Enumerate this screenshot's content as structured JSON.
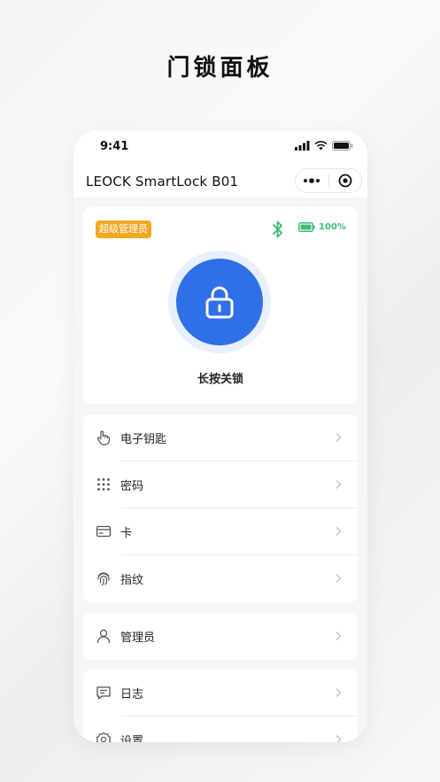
{
  "promo": {
    "title": "门锁面板"
  },
  "status_bar": {
    "time": "9:41"
  },
  "nav": {
    "title": "LEOCK SmartLock B01",
    "more_icon": "more-dots-icon",
    "close_icon": "target-icon"
  },
  "lock": {
    "role_badge": "超级管理员",
    "battery_text": "100%",
    "battery_level": 1.0,
    "caption": "长按关锁"
  },
  "colors": {
    "accent": "#2f6fe8",
    "badge": "#f5a623",
    "bluetooth": "#3fb877",
    "battery": "#3fb877"
  },
  "menu_keys": [
    {
      "label": "电子钥匙",
      "icon": "hand-tap-icon"
    },
    {
      "label": "密码",
      "icon": "keypad-icon"
    },
    {
      "label": "卡",
      "icon": "card-icon"
    },
    {
      "label": "指纹",
      "icon": "fingerprint-icon"
    }
  ],
  "menu_admin": [
    {
      "label": "管理员",
      "icon": "user-icon"
    }
  ],
  "menu_log": [
    {
      "label": "日志",
      "icon": "message-icon"
    },
    {
      "label": "设置",
      "icon": "gear-icon"
    }
  ]
}
